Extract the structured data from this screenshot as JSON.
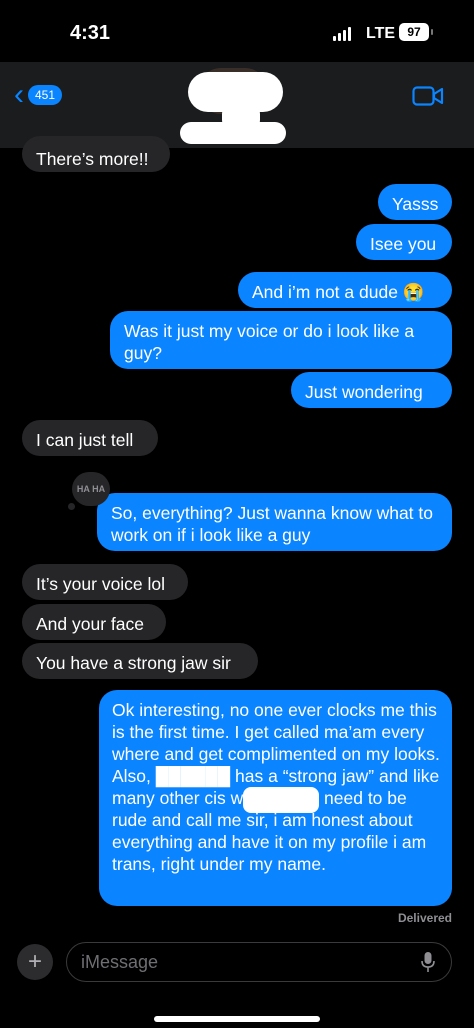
{
  "status": {
    "time": "4:31",
    "network": "LTE",
    "battery": "97"
  },
  "nav": {
    "back_count": "451"
  },
  "messages": [
    {
      "dir": "in",
      "text": "There’s more!!"
    },
    {
      "dir": "out",
      "text": "Yasss"
    },
    {
      "dir": "out",
      "text": "Isee you"
    },
    {
      "dir": "out",
      "text": "And i’m not a dude 😭"
    },
    {
      "dir": "out",
      "text": "Was it just my voice or do i look like a guy?"
    },
    {
      "dir": "out",
      "text": "Just wondering"
    },
    {
      "dir": "in",
      "text": "I can just tell"
    },
    {
      "dir": "out",
      "text": "So, everything? Just wanna know what to work on if i look like a guy",
      "tapback": "HA HA"
    },
    {
      "dir": "in",
      "text": "It’s your voice lol"
    },
    {
      "dir": "in",
      "text": "And your face"
    },
    {
      "dir": "in",
      "text": "You have a strong jaw sir"
    },
    {
      "dir": "out",
      "text": "Ok interesting, no one ever clocks me this is the first time. I get called ma’am every where and get complimented on my looks. Also, ██████ has a “strong jaw” and like many other cis women. No need to be rude and call me sir, i am honest about everything and have it on my profile i am trans, right under my name."
    }
  ],
  "delivered_label": "Delivered",
  "composer": {
    "placeholder": "iMessage"
  },
  "colors": {
    "outgoing": "#0a84ff",
    "incoming": "#262628",
    "background": "#000000"
  }
}
